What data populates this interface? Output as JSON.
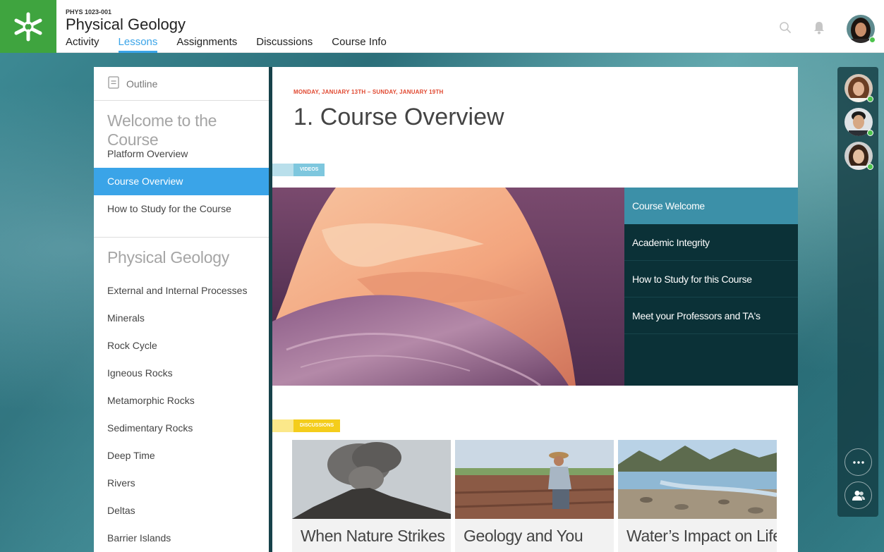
{
  "header": {
    "course_code": "PHYS 1023-001",
    "course_title": "Physical Geology",
    "nav": [
      {
        "label": "Activity",
        "active": false
      },
      {
        "label": "Lessons",
        "active": true
      },
      {
        "label": "Assignments",
        "active": false
      },
      {
        "label": "Discussions",
        "active": false
      },
      {
        "label": "Course Info",
        "active": false
      }
    ],
    "icons": {
      "search": "search-icon",
      "notifications": "bell-icon",
      "avatar": "user-avatar"
    }
  },
  "outline": {
    "label": "Outline",
    "sections": [
      {
        "title": "Welcome to the Course",
        "items": [
          "Platform Overview",
          "Course Overview",
          "How to Study for the Course"
        ]
      },
      {
        "title": "Physical Geology",
        "items": [
          "External and Internal Processes",
          "Minerals",
          "Rock Cycle",
          "Igneous Rocks",
          "Metamorphic Rocks",
          "Sedimentary Rocks",
          "Deep Time",
          "Rivers",
          "Deltas",
          "Barrier Islands"
        ]
      }
    ],
    "active_item": "Course Overview"
  },
  "lesson": {
    "date_range": "MONDAY, JANUARY 13TH – SUNDAY, JANUARY 19TH",
    "title": "1. Course Overview",
    "videos_tag": "VIDEOS",
    "playlist": [
      "Course Welcome",
      "Academic Integrity",
      "How to Study for this Course",
      "Meet your Professors and TA's"
    ],
    "discussions_tag": "DISCUSSIONS",
    "discussions": [
      "When Nature Strikes",
      "Geology and You",
      "Water’s Impact on Life"
    ]
  },
  "presence": {
    "online_count": 3,
    "more_icon": "more-icon",
    "people_icon": "people-icon"
  },
  "colors": {
    "brand_green": "#3fa43f",
    "accent_blue": "#3aa4e8",
    "date_red": "#e0472f",
    "video_tag": "#7ec7de",
    "discussion_tag": "#f4cd1b",
    "playlist_bg": "#0b3137",
    "playlist_active": "#3c90a8"
  }
}
